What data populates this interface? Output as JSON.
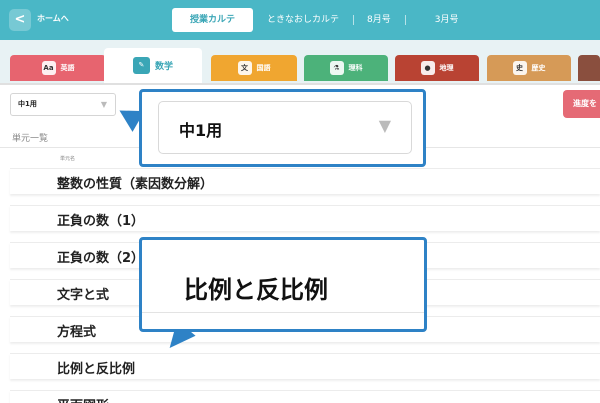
{
  "header": {
    "back_label": "<",
    "home_label": "ホームへ",
    "tabs": [
      "授業カルテ",
      "ときなおしカルテ",
      "8月号",
      "3月号"
    ]
  },
  "subjects": [
    {
      "label": "英語",
      "icon": "Aa",
      "color": "#e7646f"
    },
    {
      "label": "数学",
      "icon": "✎",
      "color": "#3aa6b6"
    },
    {
      "label": "国語",
      "icon": "文",
      "color": "#f0a630"
    },
    {
      "label": "理科",
      "icon": "⚗",
      "color": "#4cb27a"
    },
    {
      "label": "地理",
      "icon": "●",
      "color": "#b94333"
    },
    {
      "label": "歴史",
      "icon": "史",
      "color": "#d69a57"
    },
    {
      "label": "",
      "icon": "",
      "color": "#8a4f3e"
    }
  ],
  "grade_select": {
    "value": "中1用",
    "arrow": "▼"
  },
  "progress_button": "進度を",
  "unit_list_label": "単元一覧",
  "unit_col_label": "単元名",
  "units": [
    "整数の性質（素因数分解）",
    "正負の数（1）",
    "正負の数（2）",
    "文字と式",
    "方程式",
    "比例と反比例",
    "平面図形"
  ],
  "callouts": {
    "select": {
      "value": "中1用",
      "arrow": "▼"
    },
    "unit": "比例と反比例"
  },
  "colors": {
    "header": "#4ab7c6",
    "accent": "#2e82c6",
    "progress": "#e56a75"
  }
}
